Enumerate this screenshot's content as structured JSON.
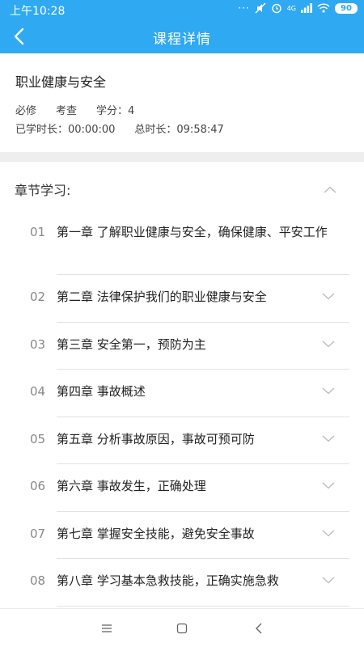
{
  "status_bar": {
    "time": "上午10:28",
    "network_label": "4G",
    "battery": "90"
  },
  "header": {
    "title": "课程详情",
    "back_icon": "chevron-left-icon",
    "accent_color": "#2fa9f2"
  },
  "course": {
    "title": "职业健康与安全",
    "type": "必修",
    "assessment": "考查",
    "credits": "学分：4",
    "studied": "已学时长：00:00:00",
    "total": "总时长：09:58:47"
  },
  "chapters": {
    "section_title": "章节学习:",
    "items": [
      {
        "num": "01",
        "title": "第一章 了解职业健康与安全，确保健康、平安工作"
      },
      {
        "num": "02",
        "title": "第二章 法律保护我们的职业健康与安全"
      },
      {
        "num": "03",
        "title": "第三章 安全第一，预防为主"
      },
      {
        "num": "04",
        "title": "第四章 事故概述"
      },
      {
        "num": "05",
        "title": "第五章 分析事故原因，事故可预可防"
      },
      {
        "num": "06",
        "title": "第六章 事故发生，正确处理"
      },
      {
        "num": "07",
        "title": "第七章 掌握安全技能，避免安全事故"
      },
      {
        "num": "08",
        "title": "第八章 学习基本急救技能，正确实施急救"
      }
    ]
  },
  "system_nav": {
    "menu_icon": "menu-icon",
    "home_icon": "home-square-icon",
    "back_icon": "back-triangle-icon"
  }
}
